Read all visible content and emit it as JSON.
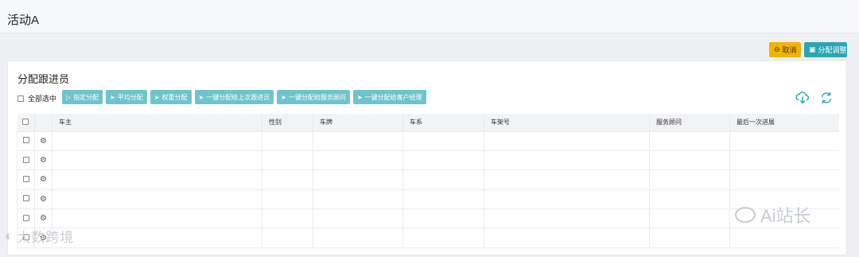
{
  "page": {
    "title": "活动A"
  },
  "top_actions": {
    "cancel_label": "取消",
    "adjust_label": "分配调整"
  },
  "panel": {
    "title": "分配跟进员",
    "select_all_label": "全部选中",
    "actions": [
      {
        "label": "指定分配",
        "icon": "play-icon"
      },
      {
        "label": "平均分配",
        "icon": "send-icon"
      },
      {
        "label": "权重分配",
        "icon": "send-icon"
      },
      {
        "label": "一键分配给上次跟进员",
        "icon": "send-icon"
      },
      {
        "label": "一键分配给服务顾问",
        "icon": "send-icon"
      },
      {
        "label": "一键分配给客户经理",
        "icon": "send-icon"
      }
    ]
  },
  "table": {
    "columns": [
      "车主",
      "性别",
      "车牌",
      "车系",
      "车架号",
      "服务顾问",
      "最后一次进展"
    ],
    "row_count": 6
  },
  "watermarks": {
    "left": "大数跨境",
    "right": "Ai站长"
  },
  "colors": {
    "cancel_bg": "#f0b400",
    "adjust_bg": "#2aa6b3",
    "action_bg": "#6fc4cc",
    "tool_icon": "#2aa6b3"
  }
}
